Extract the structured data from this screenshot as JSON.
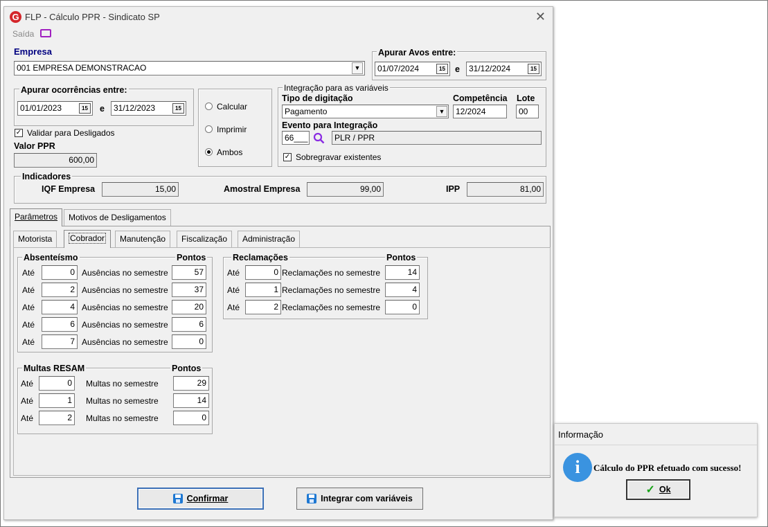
{
  "window": {
    "title": "FLP - Cálculo PPR - Sindicato SP",
    "menu_saida": "Saída",
    "logo": "G"
  },
  "empresa": {
    "label": "Empresa",
    "value": "001 EMPRESA DEMONSTRACAO"
  },
  "avos": {
    "label": "Apurar Avos entre:",
    "from": "01/07/2024",
    "to": "31/12/2024",
    "sep": "e"
  },
  "ocorrencias": {
    "label": "Apurar ocorrências entre:",
    "from": "01/01/2023",
    "to": "31/12/2023",
    "sep": "e"
  },
  "validar": {
    "label": "Validar para Desligados",
    "checked": true
  },
  "valor_ppr": {
    "label": "Valor PPR",
    "value": "600,00"
  },
  "modo": {
    "calcular": "Calcular",
    "imprimir": "Imprimir",
    "ambos": "Ambos",
    "selected": "Ambos"
  },
  "integracao": {
    "group_label": "Integração para as variáveis",
    "tipo_label": "Tipo de digitação",
    "tipo_value": "Pagamento",
    "competencia_label": "Competência",
    "competencia_value": "12/2024",
    "lote_label": "Lote",
    "lote_value": "00",
    "evento_label": "Evento para Integração",
    "evento_code": "66___",
    "evento_desc": "PLR / PPR",
    "sobregravar": "Sobregravar existentes"
  },
  "indicadores": {
    "label": "Indicadores",
    "iqf_label": "IQF Empresa",
    "iqf_value": "15,00",
    "amostral_label": "Amostral Empresa",
    "amostral_value": "99,00",
    "ipp_label": "IPP",
    "ipp_value": "81,00"
  },
  "tabs": {
    "parametros": "Parâmetros",
    "motivos": "Motivos de Desligamentos"
  },
  "subtabs": [
    "Motorista",
    "Cobrador",
    "Manutenção",
    "Fiscalização",
    "Administração"
  ],
  "absenteismo": {
    "title": "Absenteísmo",
    "pontos": "Pontos",
    "ate": "Até",
    "desc": "Ausências no semestre",
    "rows": [
      {
        "v": "0",
        "p": "57"
      },
      {
        "v": "2",
        "p": "37"
      },
      {
        "v": "4",
        "p": "20"
      },
      {
        "v": "6",
        "p": "6"
      },
      {
        "v": "7",
        "p": "0"
      }
    ]
  },
  "reclamacoes": {
    "title": "Reclamações",
    "pontos": "Pontos",
    "ate": "Até",
    "desc": "Reclamações no semestre",
    "rows": [
      {
        "v": "0",
        "p": "14"
      },
      {
        "v": "1",
        "p": "4"
      },
      {
        "v": "2",
        "p": "0"
      }
    ]
  },
  "multas": {
    "title": "Multas RESAM",
    "pontos": "Pontos",
    "ate": "Até",
    "desc": "Multas no semestre",
    "rows": [
      {
        "v": "0",
        "p": "29"
      },
      {
        "v": "1",
        "p": "14"
      },
      {
        "v": "2",
        "p": "0"
      }
    ]
  },
  "buttons": {
    "confirmar": "Confirmar",
    "integrar": "Integrar com variáveis"
  },
  "dialog": {
    "title": "Informação",
    "message": "Cálculo do PPR efetuado com sucesso!",
    "ok": "Ok"
  }
}
